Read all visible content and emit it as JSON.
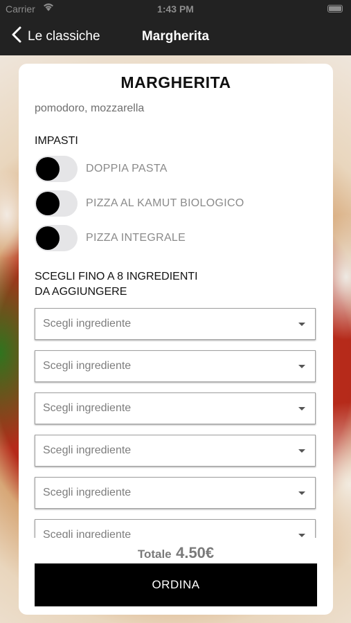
{
  "status_bar": {
    "carrier": "Carrier",
    "time": "1:43 PM"
  },
  "nav": {
    "back_label": "Le classiche",
    "title": "Margherita"
  },
  "product": {
    "name": "MARGHERITA",
    "description": "pomodoro, mozzarella"
  },
  "impasti": {
    "label": "IMPASTI",
    "options": [
      {
        "label": "DOPPIA PASTA"
      },
      {
        "label": "PIZZA AL KAMUT BIOLOGICO"
      },
      {
        "label": "PIZZA INTEGRALE"
      }
    ]
  },
  "ingredients": {
    "label_line1": "SCEGLI FINO A 8 INGREDIENTI",
    "label_line2": "DA AGGIUNGERE",
    "selects": [
      {
        "value": "Scegli ingrediente"
      },
      {
        "value": "Scegli ingrediente"
      },
      {
        "value": "Scegli ingrediente"
      },
      {
        "value": "Scegli ingrediente"
      },
      {
        "value": "Scegli ingrediente"
      },
      {
        "value": "Scegli ingrediente"
      }
    ]
  },
  "total": {
    "label": "Totale",
    "value": "4.50€"
  },
  "order_button": {
    "label": "ORDINA"
  },
  "icons": {
    "back": "chevron-left-icon",
    "wifi": "wifi-icon",
    "battery": "battery-icon",
    "caret": "caret-down-icon"
  }
}
